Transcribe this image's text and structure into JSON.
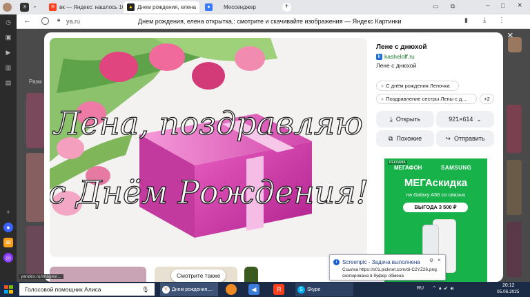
{
  "tabs": [
    {
      "label": "вк — Яндекс: нашлось 10",
      "icon": "yandex-icon"
    },
    {
      "label": "Днем рождения, елена",
      "icon": "image-icon"
    },
    {
      "label": "Мессенджер",
      "icon": "messenger-icon"
    }
  ],
  "tab_count": "3",
  "address": {
    "domain": "ya.ru",
    "page_title": "Днем рождения, елена открытка,: смотрите и скачивайте изображения — Яндекс Картинки"
  },
  "image": {
    "line1": "Лена, поздравляю",
    "line2": "с Днём Рождения!"
  },
  "details": {
    "title": "Лене с днюхой",
    "source": "kasheloff.ru",
    "description": "Лене с днюхой",
    "related_chips": [
      "С днём рождения Леночка",
      "Поздравление сестры Лены с д..."
    ],
    "more_chip": "+2",
    "open_label": "Открыть",
    "size_label": "921×614",
    "similar_label": "Похожие",
    "share_label": "Отправить"
  },
  "ad": {
    "badge": "РЕКЛАМА",
    "brand1": "МЕГАФОН",
    "brand2": "SAMSUNG",
    "headline": "МЕГАскидка",
    "subline": "на Galaxy A56 со связью",
    "benefit": "ВЫГОДА 3 500 ₽"
  },
  "bottom": {
    "see_also": "Смотрите также",
    "status_url": "yandex.ru/images/...",
    "left_tab_label": "Разм"
  },
  "notification": {
    "title": "Screenpic - Задача выполнена",
    "line1": "Ссылка https://s01.picknet.com/di-C2YZ26.png",
    "line2": "скопирована в буфер обмена"
  },
  "taskbar": {
    "search_label": "Голосовой помощник Алиса",
    "browser_label": "Днем рождения,...",
    "skype_label": "Skype",
    "lang": "RU",
    "time": "20:12",
    "date": "05.06.2025"
  },
  "colors": {
    "accent": "#ffdb4d",
    "ad_green": "#18b24b",
    "taskbar": "#1c2b45"
  }
}
